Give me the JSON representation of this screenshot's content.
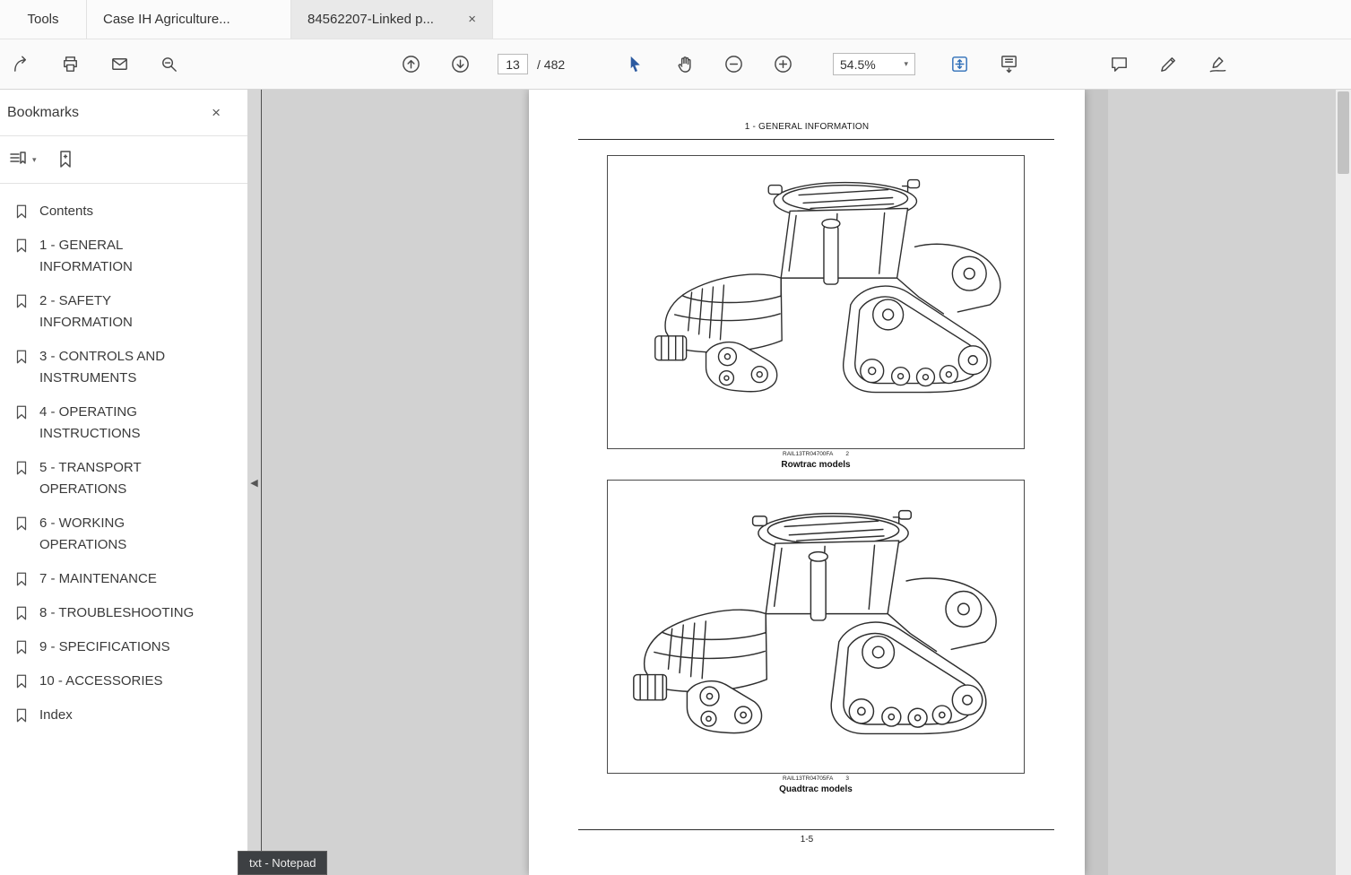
{
  "window": {
    "tabs": [
      {
        "label": "Tools"
      },
      {
        "label": "Case IH Agriculture..."
      },
      {
        "label": "84562207-Linked p...",
        "active": true
      }
    ],
    "close_glyph": "×"
  },
  "toolbar": {
    "page_current": "13",
    "page_separator": "/",
    "page_total": "482",
    "zoom_level": "54.5%"
  },
  "bookmarks": {
    "title": "Bookmarks",
    "close_glyph": "×",
    "items": [
      "Contents",
      "1 - GENERAL INFORMATION",
      "2 - SAFETY INFORMATION",
      "3 - CONTROLS AND INSTRUMENTS",
      "4 - OPERATING INSTRUCTIONS",
      "5 - TRANSPORT OPERATIONS",
      "6 - WORKING OPERATIONS",
      "7 - MAINTENANCE",
      "8 - TROUBLESHOOTING",
      "9 - SPECIFICATIONS",
      "10 - ACCESSORIES",
      "Index"
    ]
  },
  "splitter": {
    "collapse_glyph": "◀"
  },
  "document": {
    "header": "1 - GENERAL INFORMATION",
    "figures": [
      {
        "ref": "RAIL13TR04700FA",
        "num": "2",
        "caption": "Rowtrac models"
      },
      {
        "ref": "RAIL13TR04705FA",
        "num": "3",
        "caption": "Quadtrac models"
      }
    ],
    "footer_page": "1-5"
  },
  "taskbar": {
    "tooltip": "txt - Notepad"
  },
  "colors": {
    "accent_blue": "#2f6fb8",
    "doc_bg": "#d2d2d2",
    "page_bg": "#ffffff"
  }
}
